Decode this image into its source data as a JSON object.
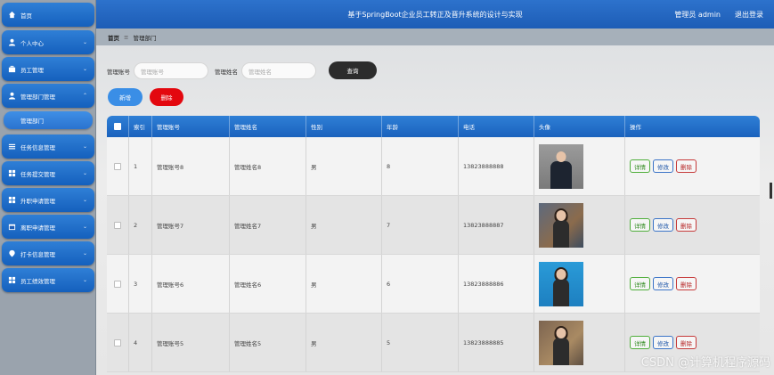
{
  "header": {
    "title": "基于SpringBoot企业员工转正及晋升系统的设计与实现",
    "admin": "管理员 admin",
    "logout": "退出登录"
  },
  "sidebar": {
    "items": [
      {
        "label": "首页",
        "icon": "home-icon"
      },
      {
        "label": "个人中心",
        "icon": "user-icon"
      },
      {
        "label": "员工管理",
        "icon": "briefcase-icon"
      },
      {
        "label": "管理部门管理",
        "icon": "user-icon"
      },
      {
        "label": "任务信息管理",
        "icon": "list-icon"
      },
      {
        "label": "任务提交管理",
        "icon": "grid-icon"
      },
      {
        "label": "升职申请管理",
        "icon": "grid-icon"
      },
      {
        "label": "离职申请管理",
        "icon": "calendar-icon"
      },
      {
        "label": "打卡信息管理",
        "icon": "pin-icon"
      },
      {
        "label": "员工绩效管理",
        "icon": "grid-icon"
      }
    ],
    "sub_item": "管理部门"
  },
  "breadcrumb": {
    "home": "首页",
    "separator": "≡",
    "current": "管理部门"
  },
  "search": {
    "account_label": "管理账号",
    "account_placeholder": "管理账号",
    "name_label": "管理姓名",
    "name_placeholder": "管理姓名",
    "query_button": "查询"
  },
  "actions": {
    "add": "新增",
    "delete": "删除"
  },
  "table": {
    "headers": [
      "索引",
      "管理账号",
      "管理姓名",
      "性别",
      "年龄",
      "电话",
      "头像",
      "操作"
    ],
    "rows": [
      {
        "index": "1",
        "account": "管理账号8",
        "name": "管理姓名8",
        "gender": "男",
        "age": "8",
        "phone": "13823888888"
      },
      {
        "index": "2",
        "account": "管理账号7",
        "name": "管理姓名7",
        "gender": "男",
        "age": "7",
        "phone": "13823888887"
      },
      {
        "index": "3",
        "account": "管理账号6",
        "name": "管理姓名6",
        "gender": "男",
        "age": "6",
        "phone": "13823888886"
      },
      {
        "index": "4",
        "account": "管理账号5",
        "name": "管理姓名5",
        "gender": "男",
        "age": "5",
        "phone": "13823888885"
      }
    ],
    "op_detail": "详情",
    "op_edit": "修改",
    "op_delete": "删除"
  },
  "watermark": "CSDN @计算机程序源码",
  "colors": {
    "primary": "#1d5db6",
    "danger": "#e3080f",
    "dark_button": "#2c2c2c"
  }
}
